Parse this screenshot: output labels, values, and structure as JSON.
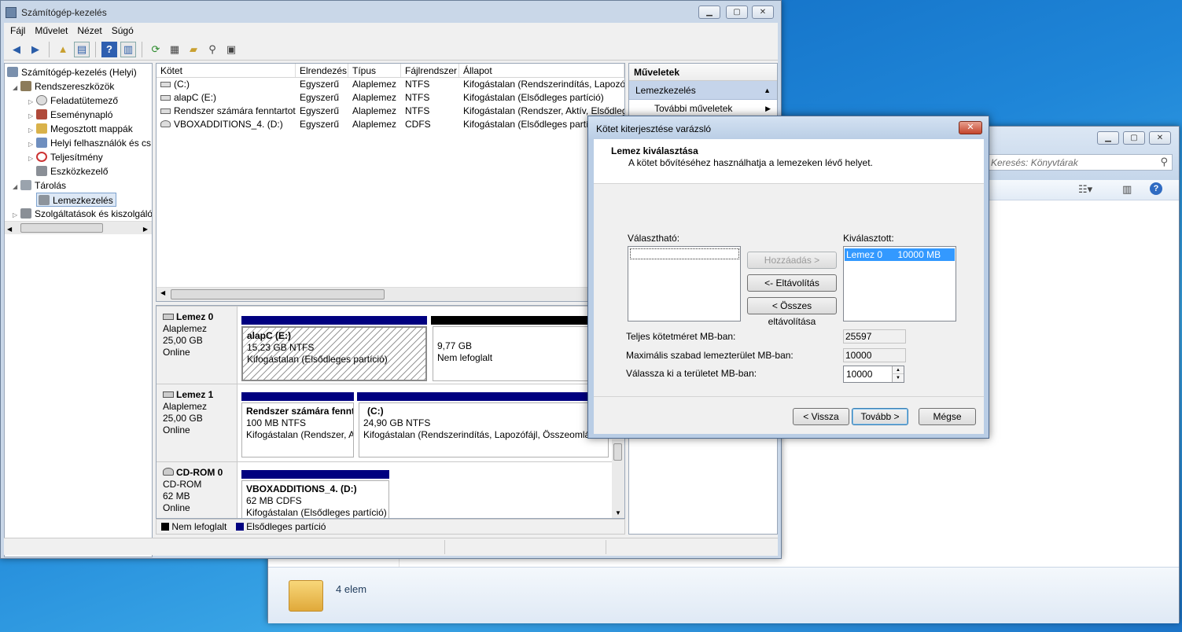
{
  "colors": {
    "accent": "#000080",
    "unalloc": "#000000",
    "selection": "#3399ff"
  },
  "explorer": {
    "search_placeholder": "Keresés: Könyvtárak",
    "item_count": "4 elem"
  },
  "mmc": {
    "title": "Számítógép-kezelés",
    "menu": [
      "Fájl",
      "Művelet",
      "Nézet",
      "Súgó"
    ],
    "tree": [
      {
        "label": "Számítógép-kezelés (Helyi)",
        "icon": "computer-management-icon"
      },
      {
        "label": "Rendszereszközök",
        "icon": "tools-icon"
      },
      {
        "label": "Feladatütemező",
        "icon": "clock-icon"
      },
      {
        "label": "Eseménynapló",
        "icon": "event-log-icon"
      },
      {
        "label": "Megosztott mappák",
        "icon": "shared-folder-icon"
      },
      {
        "label": "Helyi felhasználók és cs",
        "icon": "users-icon"
      },
      {
        "label": "Teljesítmény",
        "icon": "performance-icon"
      },
      {
        "label": "Eszközkezelő",
        "icon": "device-manager-icon"
      },
      {
        "label": "Tárolás",
        "icon": "storage-icon"
      },
      {
        "label": "Lemezkezelés",
        "icon": "disk-management-icon"
      },
      {
        "label": "Szolgáltatások és kiszolgáló",
        "icon": "services-icon"
      }
    ],
    "columns": [
      "Kötet",
      "Elrendezés",
      "Típus",
      "Fájlrendszer",
      "Állapot"
    ],
    "volumes": [
      {
        "name": "(C:)",
        "layout": "Egyszerű",
        "type": "Alaplemez",
        "fs": "NTFS",
        "status": "Kifogástalan (Rendszerindítás, Lapozóf"
      },
      {
        "name": "alapC (E:)",
        "layout": "Egyszerű",
        "type": "Alaplemez",
        "fs": "NTFS",
        "status": "Kifogástalan (Elsődleges partíció)"
      },
      {
        "name": "Rendszer számára fenntartott",
        "layout": "Egyszerű",
        "type": "Alaplemez",
        "fs": "NTFS",
        "status": "Kifogástalan (Rendszer, Aktív, Elsődleg"
      },
      {
        "name": "VBOXADDITIONS_4. (D:)",
        "layout": "Egyszerű",
        "type": "Alaplemez",
        "fs": "CDFS",
        "status": "Kifogástalan (Elsődleges partíc"
      }
    ],
    "disks": [
      {
        "name": "Lemez 0",
        "type": "Alaplemez",
        "size": "25,00 GB",
        "state": "Online",
        "parts": [
          {
            "title": "alapC  (E:)",
            "size": "15,23 GB NTFS",
            "status": "Kifogástalan (Elsődleges partíció)"
          },
          {
            "title": "",
            "size": "9,77 GB",
            "status": "Nem lefoglalt"
          }
        ]
      },
      {
        "name": "Lemez 1",
        "type": "Alaplemez",
        "size": "25,00 GB",
        "state": "Online",
        "parts": [
          {
            "title": "Rendszer számára fennt",
            "size": "100 MB NTFS",
            "status": "Kifogástalan (Rendszer, A"
          },
          {
            "title": "(C:)",
            "size": "24,90 GB NTFS",
            "status": "Kifogástalan (Rendszerindítás, Lapozófájl, Összeomlási"
          }
        ]
      },
      {
        "name": "CD-ROM 0",
        "type": "CD-ROM",
        "size": "62 MB",
        "state": "Online",
        "parts": [
          {
            "title": "VBOXADDITIONS_4.  (D:)",
            "size": "62 MB CDFS",
            "status": "Kifogástalan (Elsődleges partíció)"
          }
        ]
      }
    ],
    "legend": [
      "Nem lefoglalt",
      "Elsődleges partíció"
    ],
    "actions": {
      "header": "Műveletek",
      "section": "Lemezkezelés",
      "more": "További műveletek"
    }
  },
  "wizard": {
    "title": "Kötet kiterjesztése varázsló",
    "heading": "Lemez kiválasztása",
    "subheading": "A kötet bővítéséhez használhatja a lemezeken lévő helyet.",
    "available_label": "Választható:",
    "selected_label": "Kiválasztott:",
    "selected_items": [
      {
        "disk": "Lemez 0",
        "size": "10000 MB"
      }
    ],
    "add_btn": "Hozzáadás >",
    "remove_btn": "<- Eltávolítás",
    "remove_all_btn": "< Összes eltávolítása",
    "total_label": "Teljes kötetméret MB-ban:",
    "total_value": "25597",
    "max_label": "Maximális szabad lemezterület MB-ban:",
    "max_value": "10000",
    "choose_label": "Válassza ki a területet MB-ban:",
    "choose_value": "10000",
    "back_btn": "< Vissza",
    "next_btn": "Tovább >",
    "cancel_btn": "Mégse"
  }
}
